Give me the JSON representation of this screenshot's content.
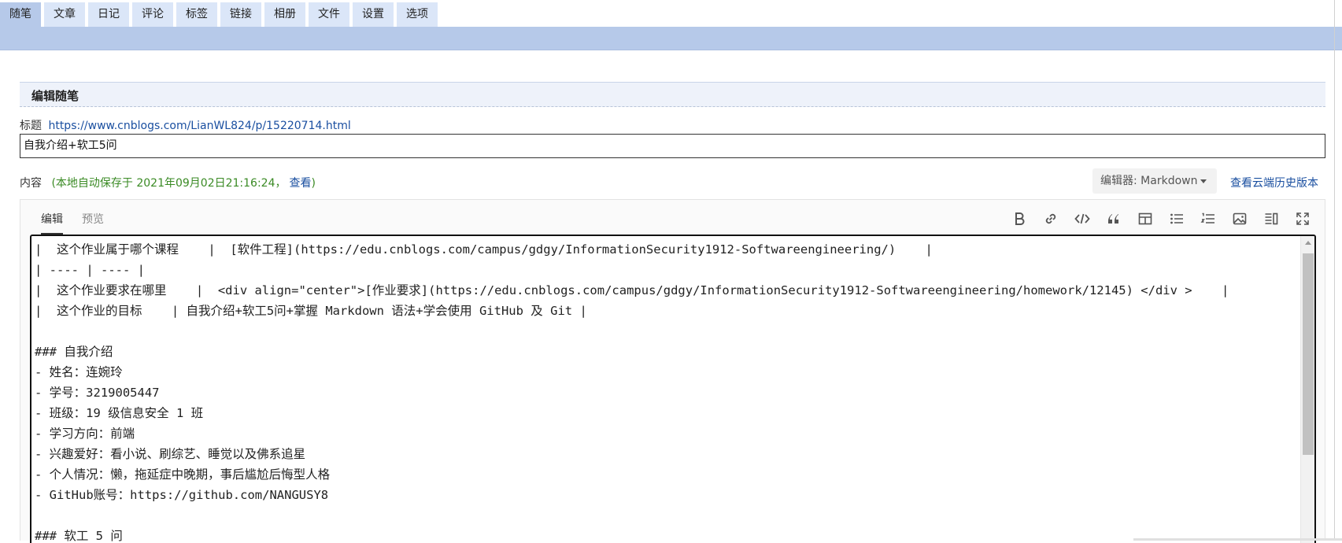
{
  "nav": {
    "tabs": [
      "随笔",
      "文章",
      "日记",
      "评论",
      "标签",
      "链接",
      "相册",
      "文件",
      "设置",
      "选项"
    ],
    "active_index": 0
  },
  "section": {
    "title": "编辑随笔"
  },
  "title_field": {
    "label": "标题",
    "url": "https://www.cnblogs.com/LianWL824/p/15220714.html",
    "value": "自我介绍+软工5问"
  },
  "content": {
    "label": "内容",
    "autosave_prefix": "(本地自动保存于 2021年09月02日21:16:24，",
    "autosave_link": "查看",
    "autosave_suffix": ")",
    "editor_select": "编辑器: Markdown",
    "history_link": "查看云端历史版本"
  },
  "editor": {
    "tabs": [
      "编辑",
      "预览"
    ],
    "toolbar_icons": [
      "bold-icon",
      "link-icon",
      "code-icon",
      "quote-icon",
      "table-icon",
      "bullet-list-icon",
      "numbered-list-icon",
      "image-icon",
      "split-view-icon",
      "fullscreen-icon"
    ],
    "lines": [
      "|  这个作业属于哪个课程    |  [软件工程](https://edu.cnblogs.com/campus/gdgy/InformationSecurity1912-Softwareengineering/)    |",
      "| ---- | ---- |",
      "|  这个作业要求在哪里    |  <div align=\"center\">[作业要求](https://edu.cnblogs.com/campus/gdgy/InformationSecurity1912-Softwareengineering/homework/12145) </div >    |",
      "|  这个作业的目标    | 自我介绍+软工5问+掌握 Markdown 语法+学会使用 GitHub 及 Git |",
      "",
      "### 自我介绍",
      "- 姓名：连婉玲",
      "- 学号：3219005447",
      "- 班级：19 级信息安全 1 班",
      "- 学习方向：前端",
      "- 兴趣爱好：看小说、刷综艺、睡觉以及佛系追星",
      "- 个人情况：懒，拖延症中晚期，事后尴尬后悔型人格",
      "- GitHub账号：https://github.com/NANGUSY8",
      "",
      "### 软工 5 问"
    ]
  }
}
